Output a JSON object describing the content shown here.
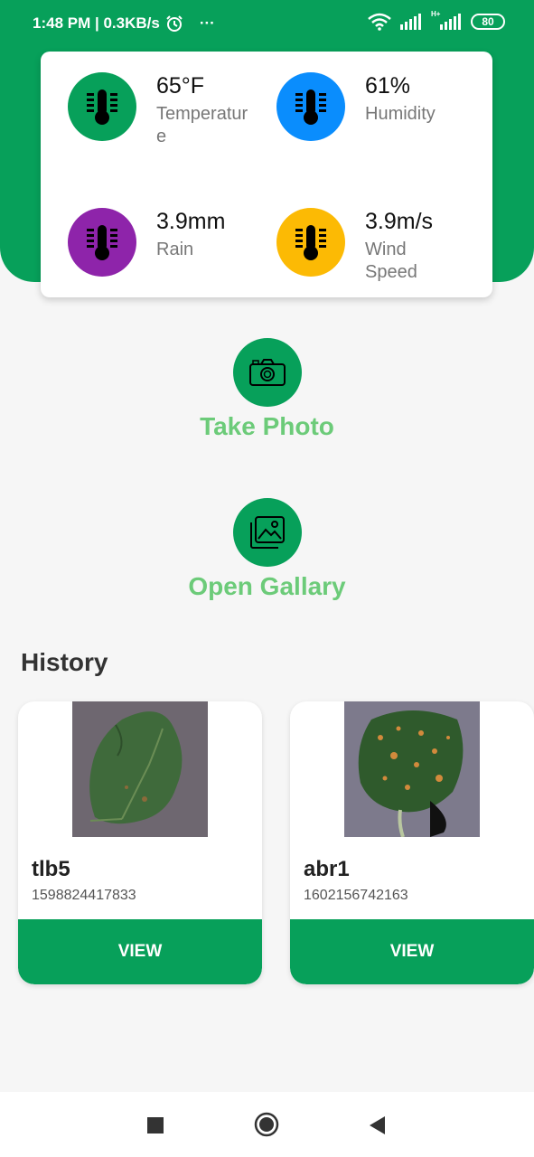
{
  "status_bar": {
    "time_speed": "1:48 PM | 0.3KB/s",
    "more": "···",
    "battery": "80",
    "network_type": "H+"
  },
  "weather": {
    "temperature": {
      "value": "65°F",
      "label": "Temperature",
      "color": "#07a05a",
      "icon": "thermometer-icon"
    },
    "humidity": {
      "value": "61%",
      "label": "Humidity",
      "color": "#0a8dfd",
      "icon": "thermometer-icon"
    },
    "rain": {
      "value": "3.9mm",
      "label": "Rain",
      "color": "#8e24aa",
      "icon": "thermometer-icon"
    },
    "wind": {
      "value": "3.9m/s",
      "label": "Wind Speed",
      "color": "#fcba04",
      "icon": "thermometer-icon"
    }
  },
  "actions": {
    "take_photo": "Take Photo",
    "open_gallery": "Open Gallary"
  },
  "history": {
    "title": "History",
    "items": [
      {
        "name": "tlb5",
        "id": "1598824417833",
        "button": "VIEW"
      },
      {
        "name": "abr1",
        "id": "1602156742163",
        "button": "VIEW"
      }
    ]
  },
  "colors": {
    "primary": "#07a05a",
    "accent_text": "#6ccb79",
    "background": "#f6f6f6"
  }
}
